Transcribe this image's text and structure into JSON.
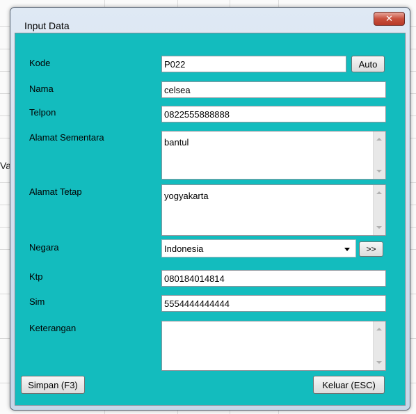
{
  "background": {
    "fragment": "Va"
  },
  "window": {
    "title": "Input Data",
    "close_glyph": "✕"
  },
  "form": {
    "kode": {
      "label": "Kode",
      "value": "P022",
      "auto_button": "Auto"
    },
    "nama": {
      "label": "Nama",
      "value": "celsea"
    },
    "telpon": {
      "label": "Telpon",
      "value": "0822555888888"
    },
    "alamat_sementara": {
      "label": "Alamat Sementara",
      "value": "bantul"
    },
    "alamat_tetap": {
      "label": "Alamat Tetap",
      "value": "yogyakarta"
    },
    "negara": {
      "label": "Negara",
      "value": "Indonesia",
      "more_button": ">>"
    },
    "ktp": {
      "label": "Ktp",
      "value": "080184014814"
    },
    "sim": {
      "label": "Sim",
      "value": "5554444444444"
    },
    "keterangan": {
      "label": "Keterangan",
      "value": ""
    }
  },
  "buttons": {
    "simpan": "Simpan (F3)",
    "keluar": "Keluar (ESC)"
  },
  "colors": {
    "client_bg": "#13bcbe",
    "close_red": "#c9503d"
  }
}
